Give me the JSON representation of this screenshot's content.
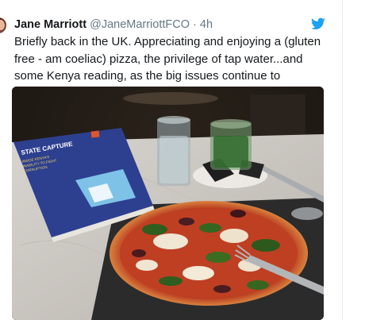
{
  "tweet": {
    "author_name": "Jane Marriott",
    "author_handle": "@JaneMarriottFCO",
    "separator": "·",
    "time": "4h",
    "text": "Briefly back in the UK. Appreciating and enjoying a (gluten free - am coeliac) pizza, the privilege of tap water...and some Kenya reading, as the big issues continue to challenge us all."
  },
  "book_cover": {
    "title": "STATE CAPTURE",
    "subtitle_line1": "INSIDE KENYA'S",
    "subtitle_line2": "INABILITY TO FIGHT",
    "subtitle_line3": "CORRUPTION"
  },
  "colors": {
    "text_primary": "#14171a",
    "text_secondary": "#657786",
    "twitter_blue": "#1da1f2",
    "border": "#e6ecf0"
  },
  "icons": {
    "brand": "twitter-bird-icon"
  }
}
